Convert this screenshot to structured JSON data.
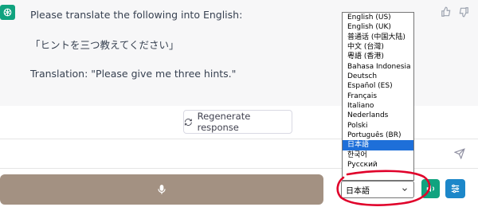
{
  "chat": {
    "line1": "Please translate the following into English:",
    "line2": "「ヒントを三つ教えてください」",
    "line3": "Translation: \"Please give me three hints.\""
  },
  "actions": {
    "regenerate_label": "Regenerate response"
  },
  "language": {
    "selected": "日本語",
    "options": [
      "English (US)",
      "English (UK)",
      "普通话 (中国大陆)",
      "中文 (台灣)",
      "粵語 (香港)",
      "Bahasa Indonesia",
      "Deutsch",
      "Español (ES)",
      "Français",
      "Italiano",
      "Nederlands",
      "Polski",
      "Português (BR)",
      "日本語",
      "한국어",
      "Русский"
    ],
    "highlighted_index": 13
  },
  "colors": {
    "brand_green": "#10a37f",
    "settings_blue": "#1c87c9",
    "mic_bar": "#a39182",
    "highlight": "#1e6fd9",
    "annotation_red": "#e0002a"
  },
  "icons": [
    "chatgpt-logo-icon",
    "thumbs-up-icon",
    "thumbs-down-icon",
    "refresh-icon",
    "send-icon",
    "microphone-icon",
    "chevron-down-icon",
    "speaker-icon",
    "settings-sliders-icon"
  ]
}
